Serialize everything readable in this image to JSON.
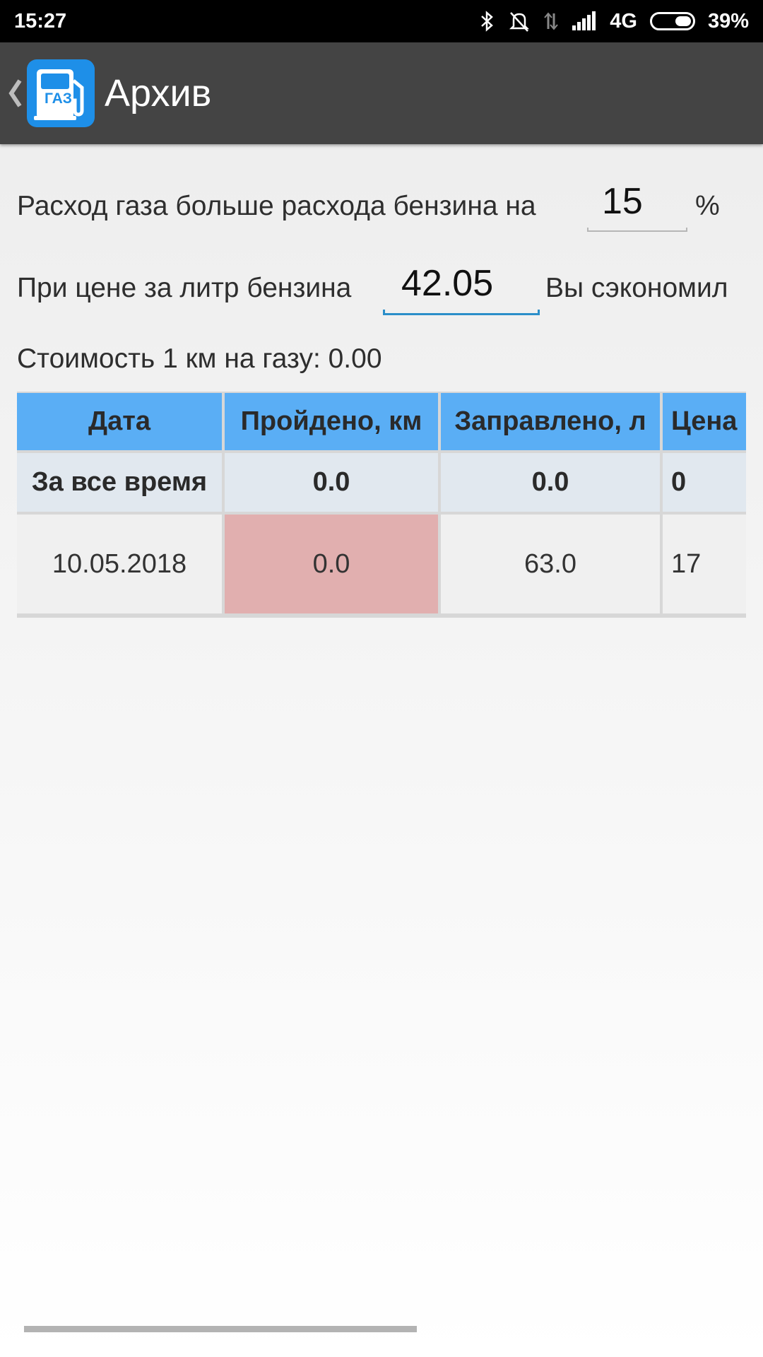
{
  "status_bar": {
    "time": "15:27",
    "network": "4G",
    "battery": "39%",
    "icons": [
      "bluetooth-icon",
      "bell-off-icon",
      "data-arrows-icon",
      "signal-icon",
      "battery-icon"
    ]
  },
  "app_bar": {
    "back_icon": "chevron-left-icon",
    "icon_text": "ГАЗ",
    "title": "Архив"
  },
  "settings": {
    "consumption_label": "Расход газа больше расхода бензина на",
    "consumption_value": "15",
    "consumption_unit": "%",
    "price_label": "При цене за литр бензина",
    "price_value": "42.05",
    "saved_label": "Вы сэкономил",
    "cost_per_km": "Стоимость 1 км на газу: 0.00"
  },
  "table": {
    "headers": [
      "Дата",
      "Пройдено, км",
      "Заправлено, л",
      "Цена"
    ],
    "totals": [
      "За все время",
      "0.0",
      "0.0",
      "0"
    ],
    "rows": [
      [
        "10.05.2018",
        "0.0",
        "63.0",
        "17"
      ]
    ]
  },
  "colors": {
    "app_bar": "#444444",
    "header_cell": "#5aaef5",
    "totals_cell": "#e1e8ef",
    "highlight_cell": "#e1afaf",
    "input_underline_active": "#2b8ec9"
  }
}
